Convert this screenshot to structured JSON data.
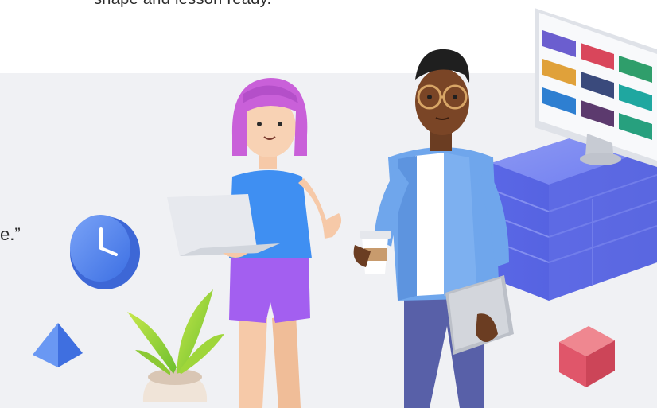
{
  "intro": {
    "text_fragment": "shape and lesson ready."
  },
  "quote": {
    "text_fragment": "e.”"
  },
  "illustration": {
    "monitor": {
      "card_colors": [
        "#6b5ecf",
        "#d9465b",
        "#2f9e6b",
        "#e0a13a",
        "#3a4a7c",
        "#1fa7a0",
        "#2e7fd1",
        "#5c3a6e",
        "#27a07e"
      ]
    },
    "objects": [
      "clock-icon",
      "pyramid",
      "cube",
      "plant",
      "laptop",
      "coffee-cup",
      "tablet",
      "block-stack"
    ]
  }
}
